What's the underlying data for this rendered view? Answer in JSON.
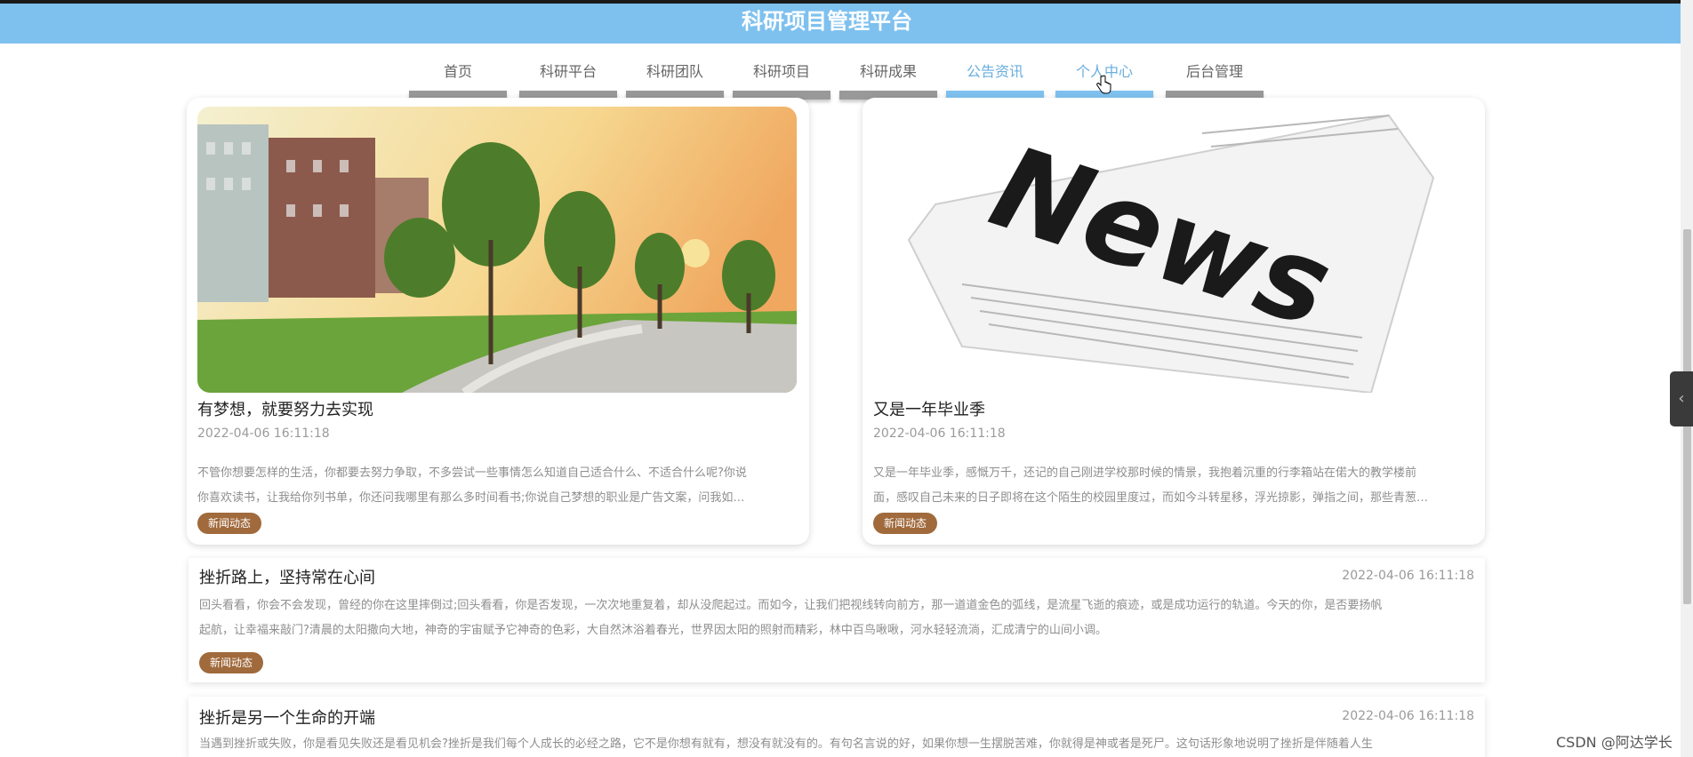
{
  "header": {
    "title": "科研项目管理平台"
  },
  "nav": [
    {
      "label": "首页"
    },
    {
      "label": "科研平台"
    },
    {
      "label": "科研团队"
    },
    {
      "label": "科研项目"
    },
    {
      "label": "科研成果"
    },
    {
      "label": "公告资讯"
    },
    {
      "label": "个人中心"
    },
    {
      "label": "后台管理"
    }
  ],
  "cards": [
    {
      "title": "有梦想，就要努力去实现",
      "date": "2022-04-06 16:11:18",
      "desc_1": "不管你想要怎样的生活，你都要去努力争取，不多尝试一些事情怎么知道自己适合什么、不适合什么呢?你说",
      "desc_2": "你喜欢读书，让我给你列书单，你还问我哪里有那么多时间看书;你说自己梦想的职业是广告文案，问我如…",
      "tag": "新闻动态"
    },
    {
      "title": "又是一年毕业季",
      "date": "2022-04-06 16:11:18",
      "desc_1": "又是一年毕业季，感慨万千，还记的自己刚进学校那时候的情景，我抱着沉重的行李箱站在偌大的教学楼前",
      "desc_2": "面，感叹自己未来的日子即将在这个陌生的校园里度过，而如今斗转星移，浮光掠影，弹指之间，那些青葱…",
      "tag": "新闻动态",
      "image_text": "News"
    }
  ],
  "rows": [
    {
      "title": "挫折路上，坚持常在心间",
      "date": "2022-04-06 16:11:18",
      "desc_1": "回头看看，你会不会发现，曾经的你在这里摔倒过;回头看看，你是否发现，一次次地重复着，却从没爬起过。而如今，让我们把视线转向前方，那一道道金色的弧线，是流星飞逝的痕迹，或是成功运行的轨道。今天的你，是否要扬帆",
      "desc_2": "起航，让幸福来敲门?清晨的太阳撒向大地，神奇的宇宙赋予它神奇的色彩，大自然沐浴着春光，世界因太阳的照射而精彩，林中百鸟啾啾，河水轻轻流淌，汇成清宁的山间小调。",
      "tag": "新闻动态"
    },
    {
      "title": "挫折是另一个生命的开端",
      "date": "2022-04-06 16:11:18",
      "desc_1": "当遇到挫折或失败，你是看见失败还是看见机会?挫折是我们每个人成长的必经之路，它不是你想有就有，想没有就没有的。有句名言说的好，如果你想一生摆脱苦难，你就得是神或者是死尸。这句话形象地说明了挫折是伴随着人生"
    }
  ],
  "watermark": "CSDN @阿达学长",
  "sidetab_icon": "chevron-left-icon",
  "colors": {
    "header": "#7ec1ef",
    "tag": "#a06a3c",
    "nav_active": "#7ec1ef"
  }
}
